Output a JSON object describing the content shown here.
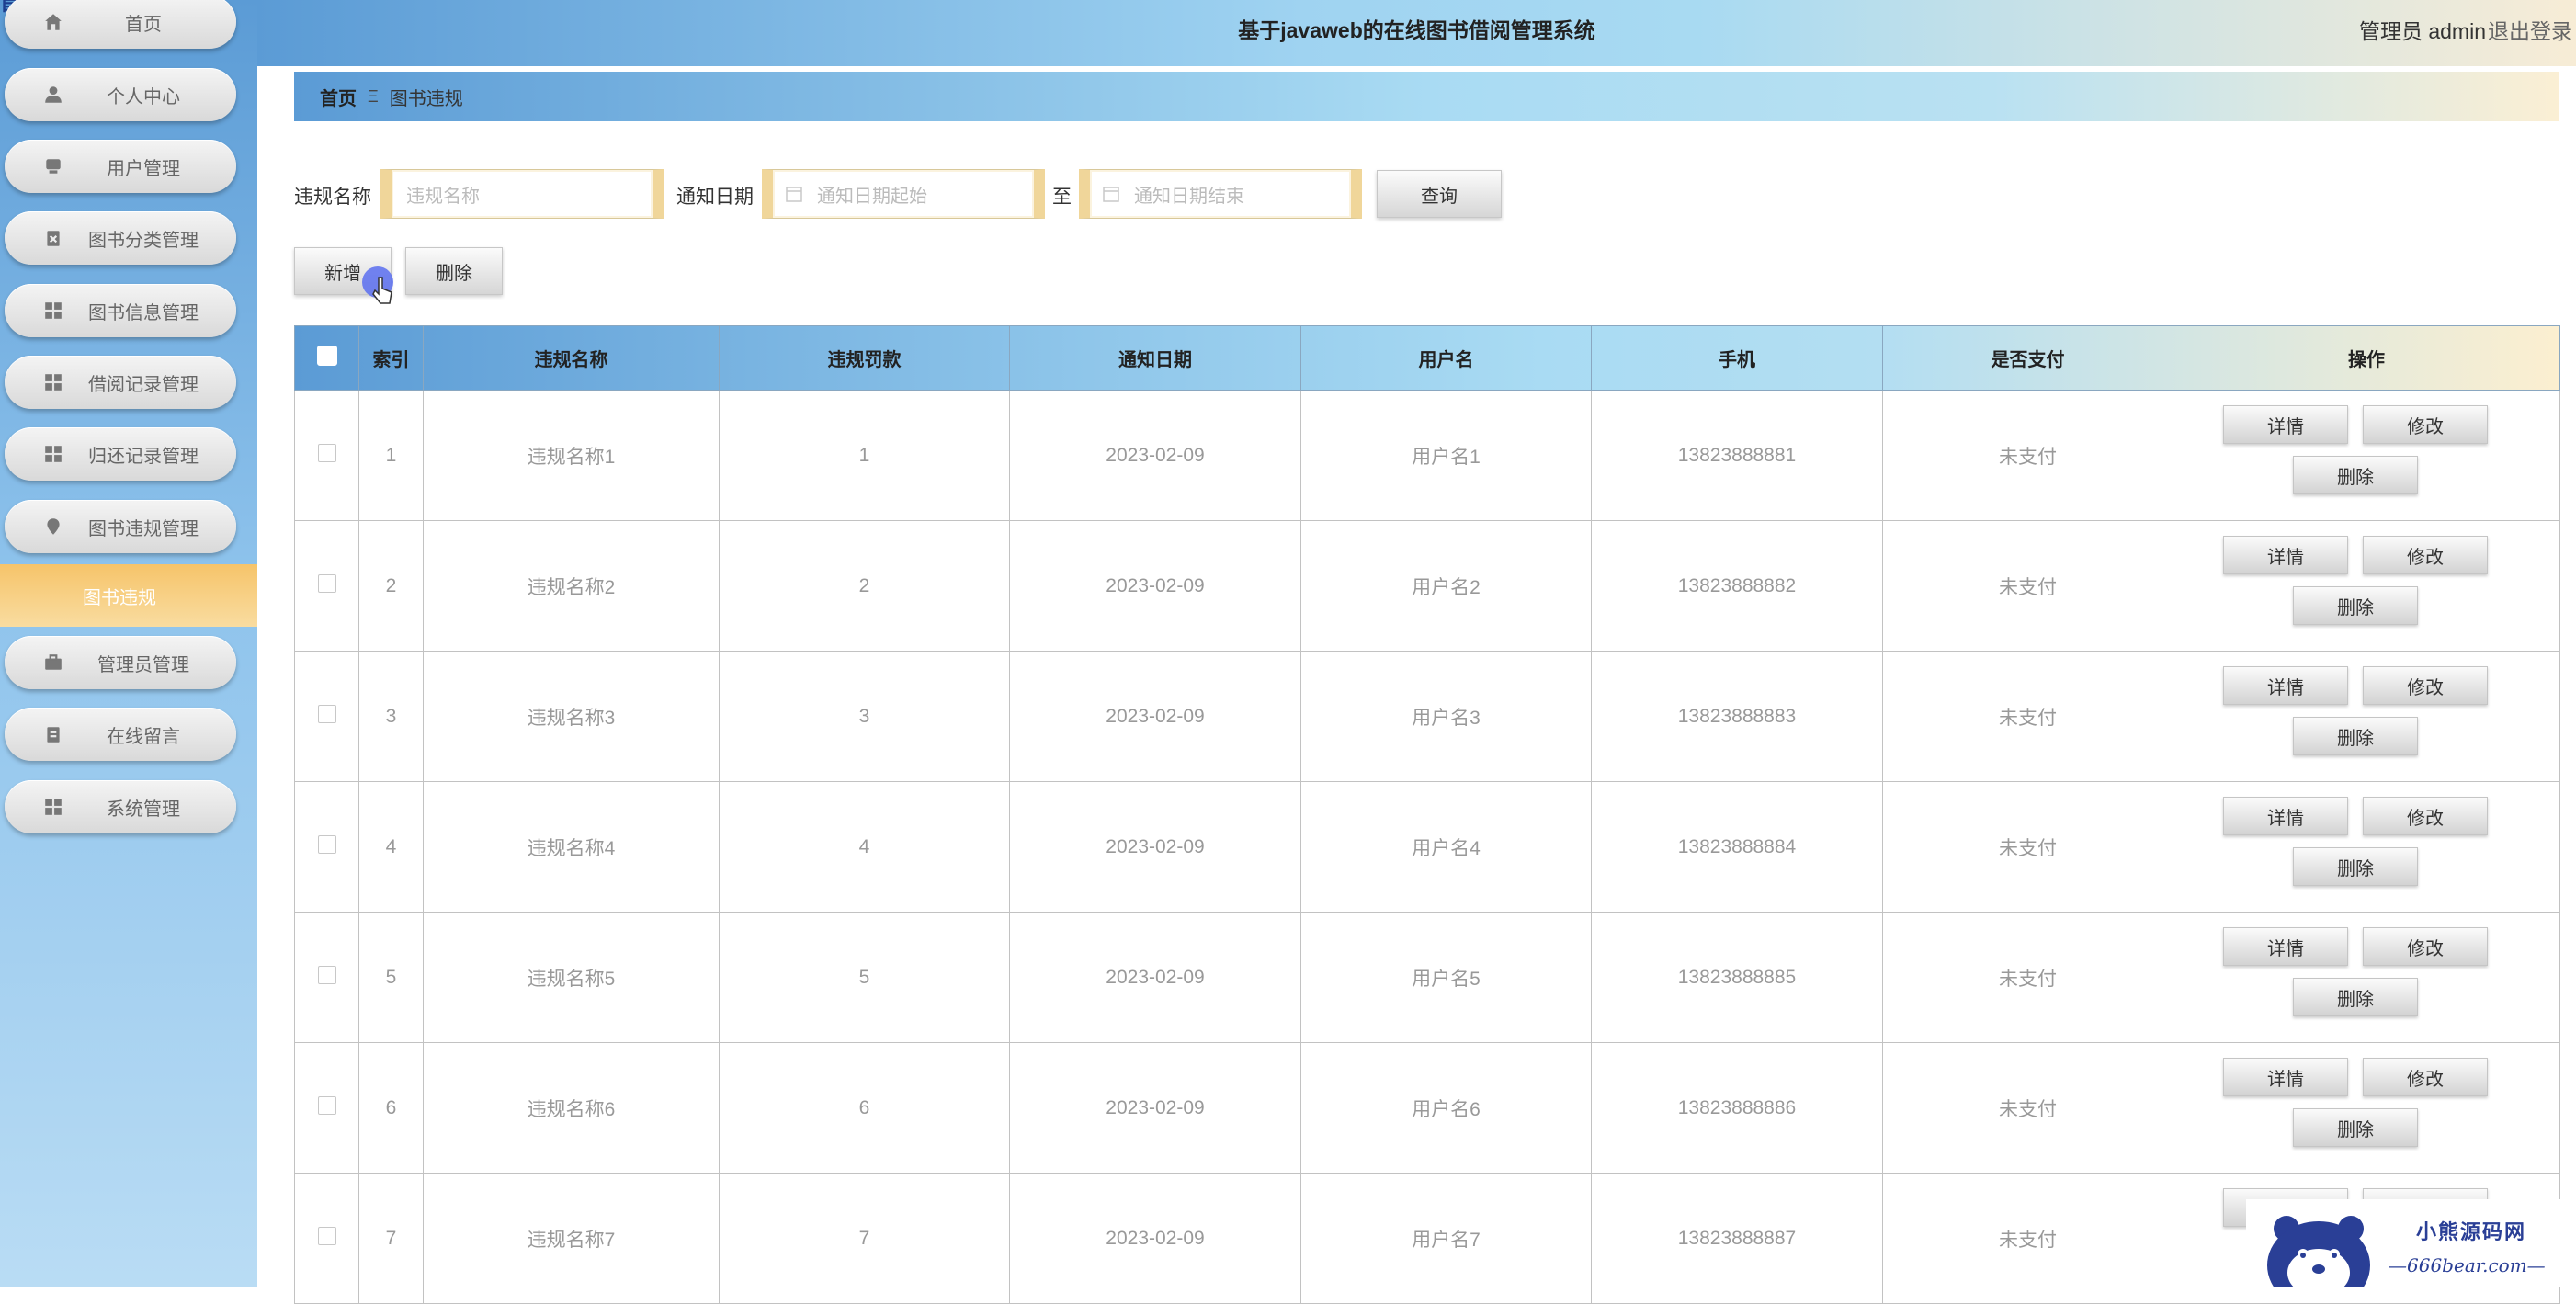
{
  "header": {
    "title": "基于javaweb的在线图书借阅管理系统",
    "user": "管理员 admin",
    "logout": "退出登录"
  },
  "sidebar": {
    "logo_fragment": "首页",
    "items": [
      {
        "label": "首页",
        "icon": "home-icon"
      },
      {
        "label": "个人中心",
        "icon": "user-icon"
      },
      {
        "label": "用户管理",
        "icon": "users-icon"
      },
      {
        "label": "图书分类管理",
        "icon": "clipboard-x-icon"
      },
      {
        "label": "图书信息管理",
        "icon": "grid-icon"
      },
      {
        "label": "借阅记录管理",
        "icon": "grid-icon"
      },
      {
        "label": "归还记录管理",
        "icon": "grid-icon"
      },
      {
        "label": "图书违规管理",
        "icon": "pin-icon"
      },
      {
        "label": "管理员管理",
        "icon": "briefcase-icon"
      },
      {
        "label": "在线留言",
        "icon": "clipboard-icon"
      },
      {
        "label": "系统管理",
        "icon": "grid-icon"
      }
    ],
    "active_sub": "图书违规"
  },
  "breadcrumb": {
    "home": "首页",
    "separator": "Ξ",
    "current": "图书违规"
  },
  "search": {
    "name_label": "违规名称",
    "name_placeholder": "违规名称",
    "date_label": "通知日期",
    "date_start_placeholder": "通知日期起始",
    "to_label": "至",
    "date_end_placeholder": "通知日期结束",
    "query_button": "查询"
  },
  "actions": {
    "add": "新增",
    "delete": "删除"
  },
  "table": {
    "columns": [
      "索引",
      "违规名称",
      "违规罚款",
      "通知日期",
      "用户名",
      "手机",
      "是否支付",
      "操作"
    ],
    "rows": [
      {
        "index": "1",
        "name": "违规名称1",
        "fine": "1",
        "date": "2023-02-09",
        "user": "用户名1",
        "phone": "13823888881",
        "paid": "未支付"
      },
      {
        "index": "2",
        "name": "违规名称2",
        "fine": "2",
        "date": "2023-02-09",
        "user": "用户名2",
        "phone": "13823888882",
        "paid": "未支付"
      },
      {
        "index": "3",
        "name": "违规名称3",
        "fine": "3",
        "date": "2023-02-09",
        "user": "用户名3",
        "phone": "13823888883",
        "paid": "未支付"
      },
      {
        "index": "4",
        "name": "违规名称4",
        "fine": "4",
        "date": "2023-02-09",
        "user": "用户名4",
        "phone": "13823888884",
        "paid": "未支付"
      },
      {
        "index": "5",
        "name": "违规名称5",
        "fine": "5",
        "date": "2023-02-09",
        "user": "用户名5",
        "phone": "13823888885",
        "paid": "未支付"
      },
      {
        "index": "6",
        "name": "违规名称6",
        "fine": "6",
        "date": "2023-02-09",
        "user": "用户名6",
        "phone": "13823888886",
        "paid": "未支付"
      },
      {
        "index": "7",
        "name": "违规名称7",
        "fine": "7",
        "date": "2023-02-09",
        "user": "用户名7",
        "phone": "13823888887",
        "paid": "未支付"
      }
    ],
    "op_labels": {
      "detail": "详情",
      "edit": "修改",
      "delete": "删除"
    }
  },
  "watermark": {
    "cn": "小熊源码网",
    "en": "—666bear.com—"
  }
}
